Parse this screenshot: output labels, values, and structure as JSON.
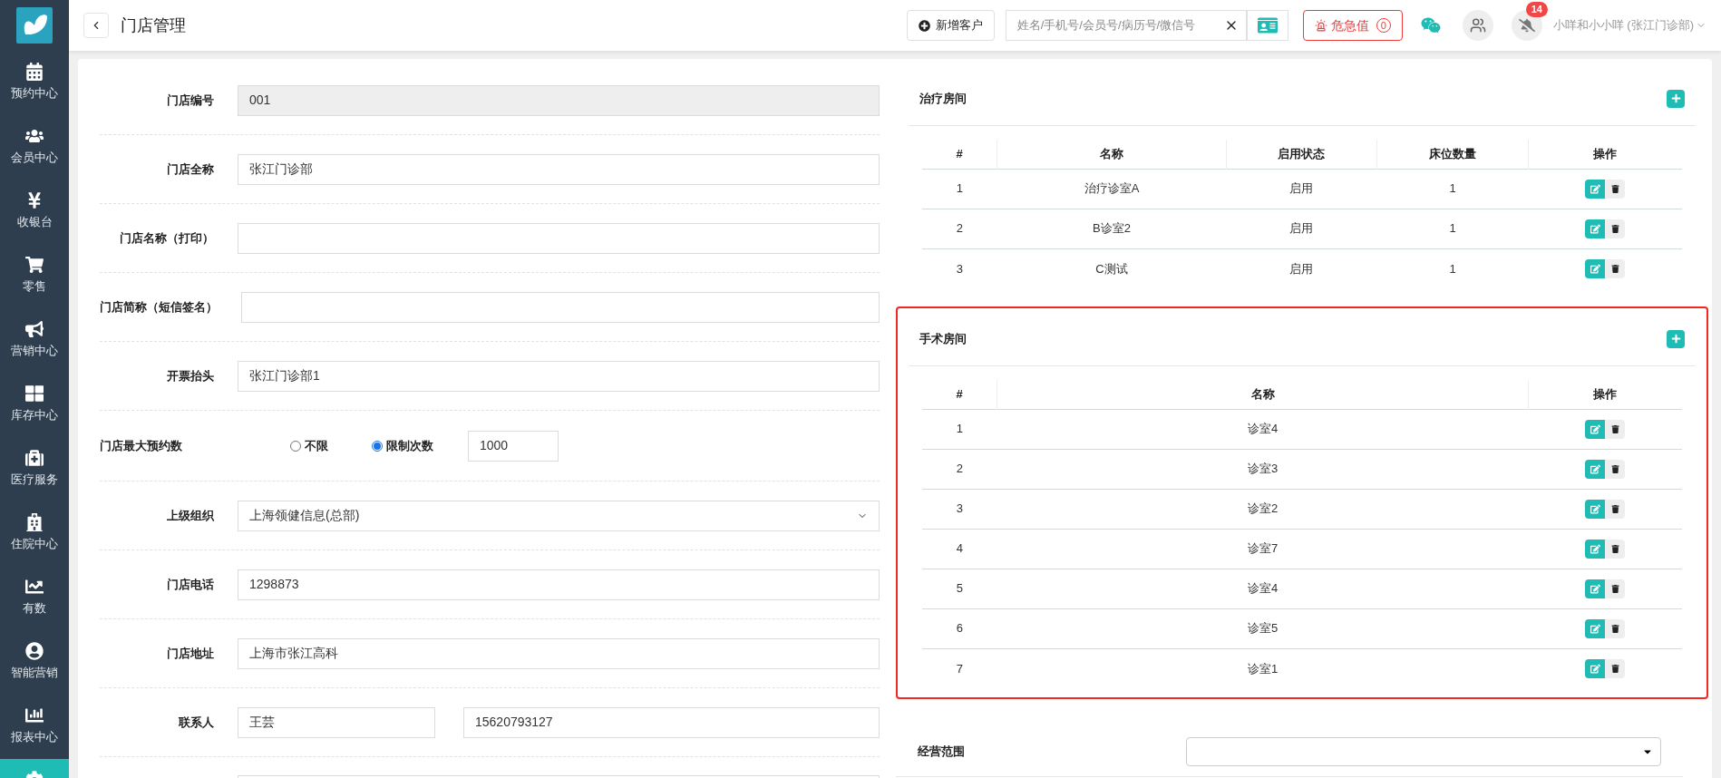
{
  "header": {
    "title": "门店管理",
    "add_customer": "新增客户",
    "search": {
      "placeholder": "姓名/手机号/会员号/病历号/微信号"
    },
    "critical": {
      "label": "危急值",
      "count": "0"
    },
    "notification_count": "14",
    "user": "小咩和小小咩 (张江门诊部)"
  },
  "sidebar": {
    "items": [
      {
        "label": "预约中心",
        "selected": false
      },
      {
        "label": "会员中心",
        "selected": false
      },
      {
        "label": "收银台",
        "selected": false
      },
      {
        "label": "零售",
        "selected": false
      },
      {
        "label": "营销中心",
        "selected": false
      },
      {
        "label": "库存中心",
        "selected": false
      },
      {
        "label": "医疗服务",
        "selected": false
      },
      {
        "label": "住院中心",
        "selected": false
      },
      {
        "label": "有数",
        "selected": false
      },
      {
        "label": "智能营销",
        "selected": false
      },
      {
        "label": "报表中心",
        "selected": false
      },
      {
        "selected": true
      }
    ]
  },
  "form": {
    "rows": [
      {
        "kind": "text",
        "label": "门店编号",
        "value": "001",
        "disabled": true
      },
      {
        "kind": "text",
        "label": "门店全称",
        "value": "张江门诊部",
        "disabled": false
      },
      {
        "kind": "text",
        "label": "门店名称（打印）",
        "disabled": false
      },
      {
        "kind": "text",
        "label": "门店简称（短信签名）",
        "disabled": false
      },
      {
        "kind": "text",
        "label": "开票抬头",
        "value": "张江门诊部1",
        "disabled": false
      },
      {
        "kind": "radio",
        "label": "门店最大预约数",
        "options": [
          {
            "label": "不限",
            "selected": false
          },
          {
            "label": "限制次数",
            "selected": true
          }
        ],
        "value": "1000"
      },
      {
        "kind": "select",
        "label": "上级组织",
        "value": "上海领健信息(总部)"
      },
      {
        "kind": "text",
        "label": "门店电话",
        "value": "1298873",
        "disabled": false
      },
      {
        "kind": "text",
        "label": "门店地址",
        "value": "上海市张江高科",
        "disabled": false
      },
      {
        "kind": "pair",
        "label": "联系人",
        "value": "王芸",
        "value_2": "15620793127"
      },
      {
        "kind": "blank"
      }
    ]
  },
  "treatment_rooms": {
    "title": "治疗房间",
    "columns": [
      "#",
      "名称",
      "启用状态",
      "床位数量",
      "操作"
    ],
    "rows": [
      {
        "cells": [
          "1",
          "治疗诊室A",
          "启用",
          "1"
        ]
      },
      {
        "cells": [
          "2",
          "B诊室2",
          "启用",
          "1"
        ]
      },
      {
        "cells": [
          "3",
          "C测试",
          "启用",
          "1"
        ]
      }
    ]
  },
  "surgery_rooms": {
    "title": "手术房间",
    "highlighted": true,
    "columns": [
      "#",
      "名称",
      "操作"
    ],
    "rows": [
      {
        "cells": [
          "1",
          "诊室4"
        ]
      },
      {
        "cells": [
          "2",
          "诊室3"
        ]
      },
      {
        "cells": [
          "3",
          "诊室2"
        ]
      },
      {
        "cells": [
          "4",
          "诊室7"
        ]
      },
      {
        "cells": [
          "5",
          "诊室4"
        ]
      },
      {
        "cells": [
          "6",
          "诊室5"
        ]
      },
      {
        "cells": [
          "7",
          "诊室1"
        ]
      }
    ]
  },
  "business_scope": {
    "label": "经营范围"
  }
}
